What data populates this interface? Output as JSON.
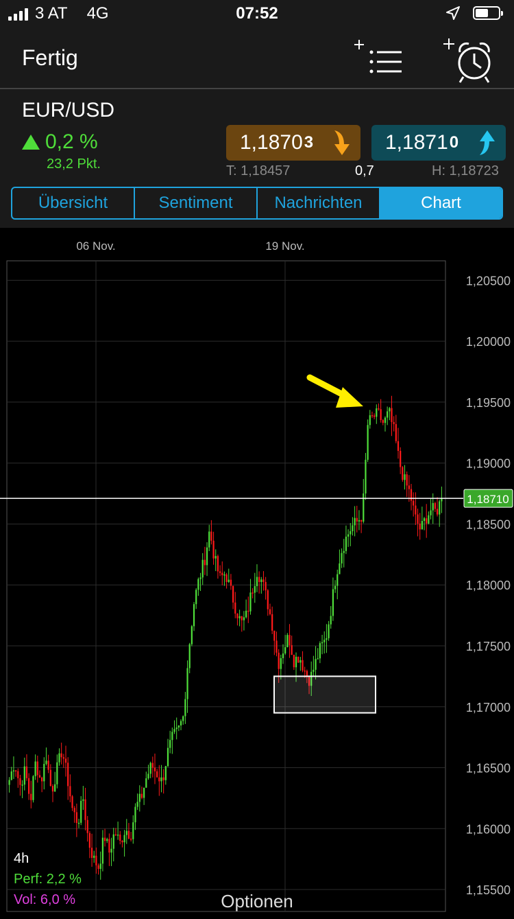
{
  "status_bar": {
    "carrier": "3 AT",
    "network": "4G",
    "time": "07:52"
  },
  "nav": {
    "done_label": "Fertig"
  },
  "instrument": {
    "symbol": "EUR/USD",
    "change_percent": "0,2 %",
    "change_points": "23,2 Pkt.",
    "sell": {
      "price_main": "1,1870",
      "price_pip": "3"
    },
    "buy": {
      "price_main": "1,1871",
      "price_pip": "0"
    },
    "low": "T: 1,18457",
    "spread": "0,7",
    "high": "H: 1,18723"
  },
  "tabs": [
    "Übersicht",
    "Sentiment",
    "Nachrichten",
    "Chart"
  ],
  "active_tab": "Chart",
  "chart_info": {
    "timeframe": "4h",
    "perf": "Perf: 2,2 %",
    "vol": "Vol: 6,0 %"
  },
  "options_label": "Optionen",
  "colors": {
    "accent": "#1fa3dd",
    "up": "#4fde3a",
    "down": "#ff1a1a",
    "sell_bg": "#6b4510",
    "buy_bg": "#0e4b57",
    "current_price_bg": "#3aa82a",
    "annotation_arrow": "#ffee00"
  },
  "chart_data": {
    "type": "candlestick",
    "x_tick_labels": [
      "06 Nov.",
      "19 Nov."
    ],
    "y_tick_labels": [
      "1,20500",
      "1,20000",
      "1,19500",
      "1,19000",
      "1,18500",
      "1,18000",
      "1,17500",
      "1,17000",
      "1,16500",
      "1,16000",
      "1,15500"
    ],
    "y_ticks": [
      1.205,
      1.2,
      1.195,
      1.19,
      1.185,
      1.18,
      1.175,
      1.17,
      1.165,
      1.16,
      1.155
    ],
    "ylim": [
      1.1532,
      1.2066
    ],
    "current_price": 1.1871,
    "current_price_label": "1,18710",
    "highlight_box": {
      "price_low": 1.1695,
      "price_high": 1.1725
    },
    "close_path": [
      1.164,
      1.1655,
      1.1635,
      1.1648,
      1.1622,
      1.1655,
      1.1638,
      1.166,
      1.163,
      1.1648,
      1.1665,
      1.1642,
      1.1615,
      1.1605,
      1.1625,
      1.159,
      1.1575,
      1.1568,
      1.1595,
      1.158,
      1.1598,
      1.1588,
      1.16,
      1.1595,
      1.1618,
      1.1625,
      1.1642,
      1.1652,
      1.1645,
      1.1638,
      1.1662,
      1.1675,
      1.168,
      1.1692,
      1.1745,
      1.1785,
      1.1805,
      1.182,
      1.1845,
      1.182,
      1.1805,
      1.181,
      1.1795,
      1.178,
      1.1768,
      1.1775,
      1.1795,
      1.1812,
      1.1802,
      1.1785,
      1.1765,
      1.1735,
      1.1748,
      1.1758,
      1.1738,
      1.1742,
      1.173,
      1.1722,
      1.1735,
      1.1748,
      1.1755,
      1.178,
      1.181,
      1.1828,
      1.184,
      1.1848,
      1.1852,
      1.1858,
      1.1932,
      1.1938,
      1.194,
      1.1932,
      1.1942,
      1.1925,
      1.19,
      1.1885,
      1.1875,
      1.1855,
      1.1845,
      1.1855,
      1.1862,
      1.186,
      1.1871
    ]
  }
}
